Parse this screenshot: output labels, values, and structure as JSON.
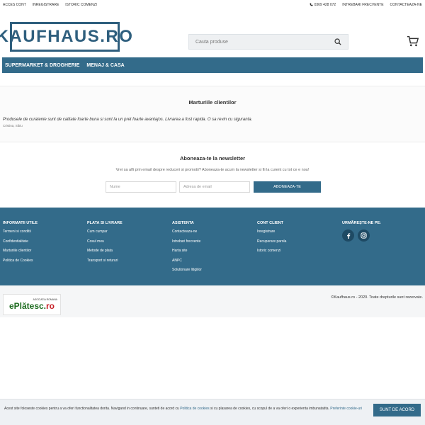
{
  "topbar": {
    "links": [
      "ACCES CONT",
      "INREGISTRARE",
      "ISTORIC COMENZI"
    ],
    "phone": "0369 428 072",
    "faq": "INTREBARI FRECVENTE",
    "contact": "CONTACTEAZA-NE"
  },
  "header": {
    "logo": "KAUFHAUS.RO",
    "search_placeholder": "Cauta produse"
  },
  "nav": {
    "items": [
      "SUPERMARKET & DROGHERIE",
      "MENAJ & CASA"
    ]
  },
  "testimonials": {
    "title": "Marturiile clientilor",
    "quote": "Produsele de curatenie sunt de calitate foarte buna si sunt la un pret foarte avantajos. Livrarea a fost rapida. O sa revin cu siguranta.",
    "author": "Cristina, Sibiu"
  },
  "newsletter": {
    "title": "Aboneaza-te la newsletter",
    "description": "Vrei sa afli prin email despre reduceri si promotii? Aboneaza-te acum la newsletter si fii la curent cu tot ce e nou!",
    "name_placeholder": "Nume",
    "email_placeholder": "Adresa de email",
    "button": "ABONEAZA-TE"
  },
  "footer": {
    "col1": {
      "title": "INFORMATII UTILE",
      "items": [
        "Termeni si conditii",
        "Confidentialitate",
        "Marturiile clientilor",
        "Politica de Cookies"
      ]
    },
    "col2": {
      "title": "PLATA SI LIVRARE",
      "items": [
        "Cum cumpar",
        "Cosul meu",
        "Metode de plata",
        "Transport si retururi"
      ]
    },
    "col3": {
      "title": "ASISTENTA",
      "items": [
        "Contacteaza-ne",
        "Intrebari frecvente",
        "Harta site",
        "ANPC",
        "Solutionare litigiilor"
      ]
    },
    "col4": {
      "title": "CONT CLIENT",
      "items": [
        "Inregistrare",
        "Recuperare parola",
        "Istoric comenzi"
      ]
    },
    "social_title": "URMĂREȘTE-NE PE:"
  },
  "bottom": {
    "payment_small": "ASOCIATIA ROMANA",
    "payment_logo_a": "ePlătesc.",
    "payment_logo_b": "ro",
    "copyright": "©Kaufhaus.ro - 2020. Toate drepturile sunt rezervate."
  },
  "cookie": {
    "text_a": "Acest site foloseste cookies pentru a va oferi functionalitatea dorita. Navigand in continuare, sunteti de acord cu ",
    "link_a": "Politica de cookies",
    "text_b": " si cu plasarea de cookies, cu scopul de a va oferi o experienta imbunatatita. ",
    "link_b": "Preferinte cookie-uri",
    "button": "SUNT DE ACORD"
  },
  "colors": {
    "brand": "#336b8a",
    "background": "#ffffff"
  }
}
